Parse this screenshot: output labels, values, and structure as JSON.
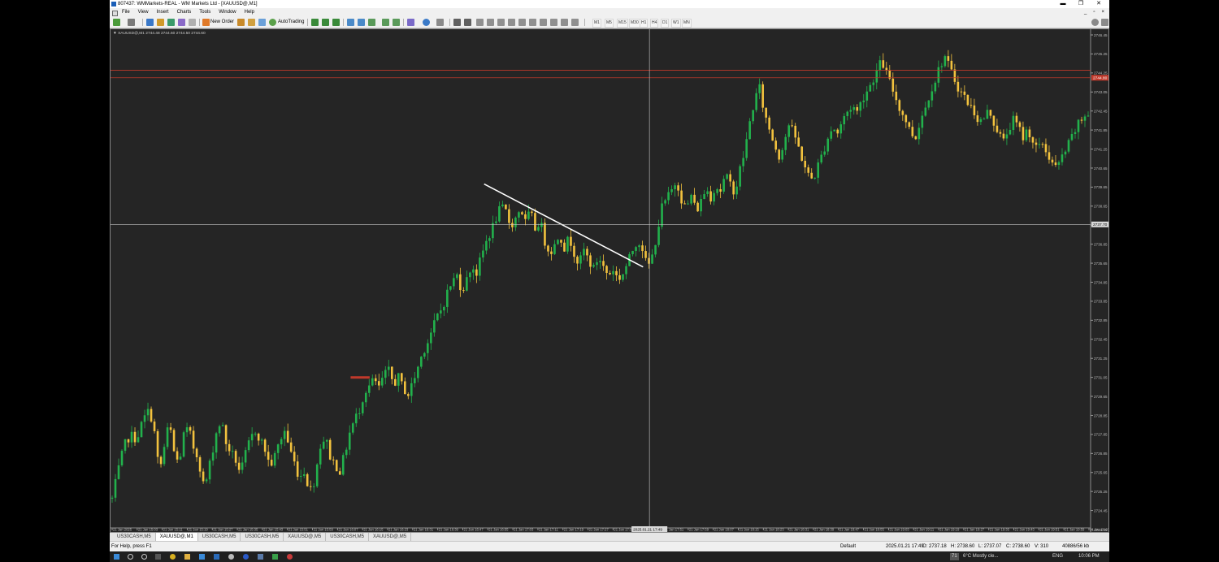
{
  "window": {
    "title": "807437: WMMarkets-REAL - WM Markets Ltd - [XAUUSD@,M1]",
    "buttons": [
      "▬",
      "❐",
      "✕"
    ]
  },
  "menu": {
    "items": [
      "File",
      "View",
      "Insert",
      "Charts",
      "Tools",
      "Window",
      "Help"
    ],
    "mdi_controls": [
      "_",
      "▫",
      "×"
    ]
  },
  "toolbar": {
    "new_order_label": "New Order",
    "autotrading_label": "AutoTrading",
    "timeframes": [
      "M1",
      "M5",
      "M15",
      "M30",
      "H1",
      "H4",
      "D1",
      "W1",
      "MN"
    ]
  },
  "chart": {
    "symbol_info": "▼ XAUUSD@,M1  2744.48 2744.60 2744.50 2744.60",
    "price_label_current": "2737.70",
    "price_label_red": "2744.80",
    "crosshair_time_label": "2025.01.21 17:49",
    "chart_data": {
      "type": "candlestick",
      "symbol": "XAUUSD@",
      "timeframe": "M1",
      "y_ticks": [
        "2746.45",
        "2745.25",
        "2744.25",
        "2743.05",
        "2742.45",
        "2741.85",
        "2741.25",
        "2740.65",
        "2739.65",
        "2738.65",
        "2737.45",
        "2736.85",
        "2735.65",
        "2734.85",
        "2733.85",
        "2732.85",
        "2732.45",
        "2731.25",
        "2731.05",
        "2729.65",
        "2728.85",
        "2727.85",
        "2726.85",
        "2725.65",
        "2725.25",
        "2724.45",
        "2723.45"
      ],
      "x_ticks": [
        "21 Jan 2025",
        "21 Jan 15:03",
        "21 Jan 15:11",
        "21 Jan 15:19",
        "21 Jan 15:27",
        "21 Jan 15:35",
        "21 Jan 15:43",
        "21 Jan 15:51",
        "21 Jan 15:59",
        "21 Jan 16:07",
        "21 Jan 16:15",
        "21 Jan 16:23",
        "21 Jan 16:31",
        "21 Jan 16:39",
        "21 Jan 16:47",
        "21 Jan 16:55",
        "21 Jan 17:03",
        "21 Jan 17:11",
        "21 Jan 17:19",
        "21 Jan 17:27",
        "21 Jan 17:35",
        "21 Jan 17:43",
        "21 Jan 17:51",
        "21 Jan 17:59",
        "21 Jan 18:07",
        "21 Jan 18:15",
        "21 Jan 18:23",
        "21 Jan 18:31",
        "21 Jan 18:39",
        "21 Jan 18:47",
        "21 Jan 18:55",
        "21 Jan 19:03",
        "21 Jan 19:11",
        "21 Jan 19:19",
        "21 Jan 19:27",
        "21 Jan 19:35",
        "21 Jan 19:43",
        "21 Jan 19:51",
        "21 Jan 19:59",
        "21 Jan 20:07"
      ],
      "ylim": [
        2723.5,
        2746.5
      ],
      "horizontal_lines": [
        2744.95,
        2744.6
      ],
      "crosshair_price": 2737.7,
      "close_path": [
        [
          0,
          2724.8
        ],
        [
          8,
          2726.2
        ],
        [
          15,
          2727.3
        ],
        [
          22,
          2727.8
        ],
        [
          30,
          2727.6
        ],
        [
          38,
          2728.5
        ],
        [
          46,
          2729.0
        ],
        [
          52,
          2727.9
        ],
        [
          58,
          2726.0
        ],
        [
          64,
          2727.2
        ],
        [
          70,
          2728.4
        ],
        [
          76,
          2727.0
        ],
        [
          82,
          2726.4
        ],
        [
          88,
          2727.8
        ],
        [
          94,
          2728.1
        ],
        [
          100,
          2727.2
        ],
        [
          106,
          2726.7
        ],
        [
          112,
          2725.5
        ],
        [
          116,
          2725.7
        ],
        [
          122,
          2726.8
        ],
        [
          128,
          2727.9
        ],
        [
          134,
          2728.5
        ],
        [
          140,
          2727.4
        ],
        [
          146,
          2727.0
        ],
        [
          152,
          2726.6
        ],
        [
          158,
          2726.0
        ],
        [
          164,
          2726.9
        ],
        [
          170,
          2727.6
        ],
        [
          176,
          2728.0
        ],
        [
          182,
          2727.6
        ],
        [
          188,
          2727.1
        ],
        [
          194,
          2726.3
        ],
        [
          200,
          2726.8
        ],
        [
          206,
          2727.5
        ],
        [
          212,
          2728.0
        ],
        [
          218,
          2727.2
        ],
        [
          224,
          2726.5
        ],
        [
          230,
          2725.8
        ],
        [
          236,
          2726.1
        ],
        [
          242,
          2725.3
        ],
        [
          246,
          2725.2
        ],
        [
          250,
          2726.0
        ],
        [
          256,
          2727.3
        ],
        [
          262,
          2727.7
        ],
        [
          268,
          2726.8
        ],
        [
          274,
          2726.4
        ],
        [
          280,
          2726.1
        ],
        [
          286,
          2726.9
        ],
        [
          292,
          2727.9
        ],
        [
          298,
          2728.5
        ],
        [
          304,
          2729.0
        ],
        [
          310,
          2729.8
        ],
        [
          316,
          2730.1
        ],
        [
          322,
          2730.4
        ],
        [
          328,
          2730.0
        ],
        [
          334,
          2730.6
        ],
        [
          340,
          2730.8
        ],
        [
          346,
          2730.2
        ],
        [
          352,
          2730.5
        ],
        [
          358,
          2730.0
        ],
        [
          364,
          2729.7
        ],
        [
          370,
          2730.3
        ],
        [
          376,
          2731.0
        ],
        [
          382,
          2731.7
        ],
        [
          388,
          2732.2
        ],
        [
          394,
          2732.8
        ],
        [
          400,
          2733.4
        ],
        [
          406,
          2733.8
        ],
        [
          412,
          2734.5
        ],
        [
          418,
          2735.0
        ],
        [
          424,
          2735.3
        ],
        [
          430,
          2734.6
        ],
        [
          436,
          2735.1
        ],
        [
          442,
          2735.8
        ],
        [
          448,
          2735.4
        ],
        [
          454,
          2736.2
        ],
        [
          460,
          2736.9
        ],
        [
          466,
          2737.4
        ],
        [
          472,
          2738.0
        ],
        [
          478,
          2738.5
        ],
        [
          484,
          2738.3
        ],
        [
          490,
          2737.6
        ],
        [
          496,
          2738.0
        ],
        [
          502,
          2738.5
        ],
        [
          508,
          2737.8
        ],
        [
          514,
          2738.3
        ],
        [
          520,
          2737.5
        ],
        [
          526,
          2737.9
        ],
        [
          532,
          2736.9
        ],
        [
          538,
          2736.4
        ],
        [
          544,
          2736.7
        ],
        [
          550,
          2737.3
        ],
        [
          556,
          2736.6
        ],
        [
          562,
          2737.1
        ],
        [
          568,
          2736.4
        ],
        [
          574,
          2735.8
        ],
        [
          580,
          2736.5
        ],
        [
          586,
          2736.0
        ],
        [
          592,
          2735.6
        ],
        [
          598,
          2736.2
        ],
        [
          604,
          2735.7
        ],
        [
          610,
          2735.3
        ],
        [
          616,
          2735.6
        ],
        [
          622,
          2735.1
        ],
        [
          628,
          2735.4
        ],
        [
          634,
          2735.9
        ],
        [
          640,
          2736.5
        ],
        [
          646,
          2737.0
        ],
        [
          652,
          2736.6
        ],
        [
          658,
          2735.6
        ],
        [
          664,
          2736.2
        ],
        [
          670,
          2737.3
        ],
        [
          676,
          2738.5
        ],
        [
          682,
          2738.9
        ],
        [
          688,
          2739.3
        ],
        [
          694,
          2739.8
        ],
        [
          700,
          2738.9
        ],
        [
          706,
          2738.4
        ],
        [
          712,
          2739.1
        ],
        [
          718,
          2738.3
        ],
        [
          724,
          2738.8
        ],
        [
          730,
          2739.4
        ],
        [
          736,
          2739.0
        ],
        [
          742,
          2739.5
        ],
        [
          748,
          2739.3
        ],
        [
          754,
          2740.0
        ],
        [
          760,
          2739.6
        ],
        [
          766,
          2739.2
        ],
        [
          772,
          2740.3
        ],
        [
          778,
          2741.2
        ],
        [
          784,
          2742.5
        ],
        [
          790,
          2743.6
        ],
        [
          796,
          2744.1
        ],
        [
          802,
          2742.9
        ],
        [
          808,
          2742.2
        ],
        [
          814,
          2741.5
        ],
        [
          820,
          2740.9
        ],
        [
          826,
          2741.6
        ],
        [
          832,
          2742.4
        ],
        [
          838,
          2742.0
        ],
        [
          844,
          2741.3
        ],
        [
          850,
          2740.6
        ],
        [
          856,
          2740.0
        ],
        [
          862,
          2739.8
        ],
        [
          868,
          2740.5
        ],
        [
          874,
          2741.1
        ],
        [
          880,
          2741.8
        ],
        [
          886,
          2742.3
        ],
        [
          892,
          2742.0
        ],
        [
          898,
          2742.6
        ],
        [
          904,
          2743.0
        ],
        [
          910,
          2743.3
        ],
        [
          916,
          2743.0
        ],
        [
          922,
          2743.6
        ],
        [
          928,
          2744.0
        ],
        [
          934,
          2744.4
        ],
        [
          940,
          2744.9
        ],
        [
          946,
          2745.4
        ],
        [
          952,
          2744.8
        ],
        [
          958,
          2744.2
        ],
        [
          964,
          2743.6
        ],
        [
          970,
          2743.0
        ],
        [
          976,
          2742.6
        ],
        [
          982,
          2742.0
        ],
        [
          988,
          2741.8
        ],
        [
          994,
          2742.7
        ],
        [
          1000,
          2743.2
        ],
        [
          1006,
          2744.0
        ],
        [
          1012,
          2744.5
        ],
        [
          1018,
          2745.2
        ],
        [
          1024,
          2745.6
        ],
        [
          1030,
          2745.0
        ],
        [
          1036,
          2744.5
        ],
        [
          1042,
          2744.0
        ],
        [
          1048,
          2743.7
        ],
        [
          1054,
          2743.3
        ],
        [
          1060,
          2743.0
        ],
        [
          1066,
          2742.5
        ],
        [
          1072,
          2742.7
        ],
        [
          1078,
          2743.1
        ],
        [
          1084,
          2742.5
        ],
        [
          1090,
          2742.0
        ],
        [
          1096,
          2741.6
        ],
        [
          1102,
          2742.2
        ],
        [
          1108,
          2742.6
        ],
        [
          1114,
          2742.3
        ],
        [
          1120,
          2741.8
        ],
        [
          1126,
          2742.2
        ],
        [
          1132,
          2741.6
        ],
        [
          1138,
          2741.2
        ],
        [
          1144,
          2741.5
        ],
        [
          1150,
          2741.0
        ],
        [
          1156,
          2740.6
        ],
        [
          1162,
          2740.3
        ],
        [
          1168,
          2740.9
        ],
        [
          1174,
          2741.3
        ],
        [
          1180,
          2741.8
        ],
        [
          1186,
          2742.3
        ],
        [
          1192,
          2742.6
        ],
        [
          1198,
          2743.0
        ],
        [
          1202,
          2742.7
        ]
      ],
      "trendline": {
        "from": [
          "21 Jan 16:57",
          2739.6
        ],
        "to": [
          "21 Jan 17:47",
          2735.7
        ]
      },
      "red_marker": {
        "from": [
          "21 Jan 16:15",
          2730.5
        ],
        "to": [
          "21 Jan 16:21",
          2730.5
        ]
      }
    }
  },
  "tabs": [
    "US30CASH,M5",
    "XAUUSD@,M1",
    "US30CASH,M5",
    "US30CASH,M5",
    "XAUUSD@,M5",
    "US30CASH,M5",
    "XAUUSD@,M5"
  ],
  "active_tab_index": 1,
  "status": {
    "help": "For Help, press F1",
    "profile": "Default",
    "datetime": "2025.01.21 17:49",
    "open": "O: 2737.18",
    "high": "H: 2738.60",
    "low": "L: 2737.07",
    "close": "C: 2738.60",
    "volume": "V: 310",
    "traffic": "40886/56 kb"
  },
  "taskbar": {
    "weather": "6°C  Mostly cle...",
    "lang": "ENG",
    "time": "10:06 PM",
    "badge": "71"
  }
}
